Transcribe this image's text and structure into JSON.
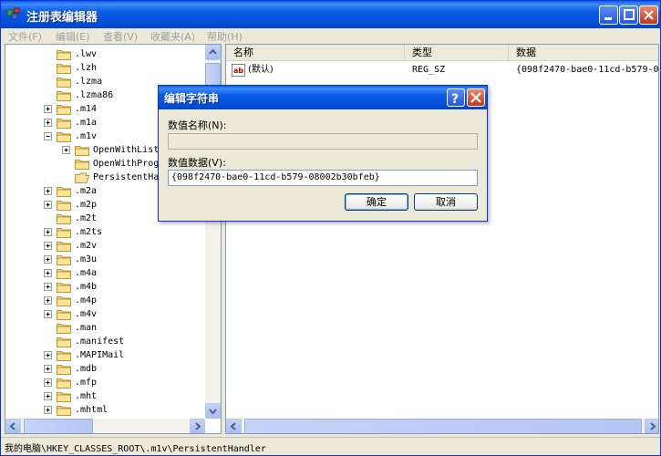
{
  "window": {
    "title": "注册表编辑器"
  },
  "menu": [
    "文件(F)",
    "编辑(E)",
    "查看(V)",
    "收藏夹(A)",
    "帮助(H)"
  ],
  "tree": {
    "rows": [
      {
        "label": ".lwv",
        "expander": false,
        "indent": 0
      },
      {
        "label": ".lzh",
        "expander": false,
        "indent": 0
      },
      {
        "label": ".lzma",
        "expander": false,
        "indent": 0
      },
      {
        "label": ".lzma86",
        "expander": false,
        "indent": 0
      },
      {
        "label": ".m14",
        "expander": true,
        "indent": 0
      },
      {
        "label": ".m1a",
        "expander": true,
        "indent": 0
      },
      {
        "label": ".m1v",
        "expander": "open",
        "indent": 0
      },
      {
        "label": "OpenWithList",
        "expander": true,
        "indent": 1
      },
      {
        "label": "OpenWithProgI",
        "expander": false,
        "indent": 1
      },
      {
        "label": "PersistentHan",
        "expander": false,
        "indent": 1,
        "open": true
      },
      {
        "label": ".m2a",
        "expander": true,
        "indent": 0
      },
      {
        "label": ".m2p",
        "expander": true,
        "indent": 0
      },
      {
        "label": ".m2t",
        "expander": false,
        "indent": 0
      },
      {
        "label": ".m2ts",
        "expander": true,
        "indent": 0
      },
      {
        "label": ".m2v",
        "expander": true,
        "indent": 0
      },
      {
        "label": ".m3u",
        "expander": true,
        "indent": 0
      },
      {
        "label": ".m4a",
        "expander": true,
        "indent": 0
      },
      {
        "label": ".m4b",
        "expander": true,
        "indent": 0
      },
      {
        "label": ".m4p",
        "expander": true,
        "indent": 0
      },
      {
        "label": ".m4v",
        "expander": true,
        "indent": 0
      },
      {
        "label": ".man",
        "expander": false,
        "indent": 0
      },
      {
        "label": ".manifest",
        "expander": false,
        "indent": 0
      },
      {
        "label": ".MAPIMail",
        "expander": true,
        "indent": 0
      },
      {
        "label": ".mdb",
        "expander": true,
        "indent": 0
      },
      {
        "label": ".mfp",
        "expander": true,
        "indent": 0
      },
      {
        "label": ".mht",
        "expander": true,
        "indent": 0
      },
      {
        "label": ".mhtml",
        "expander": true,
        "indent": 0
      }
    ]
  },
  "list": {
    "columns": [
      "名称",
      "类型",
      "数据"
    ],
    "rows": [
      {
        "icon": "ab",
        "name": "(默认)",
        "type": "REG_SZ",
        "data": "{098f2470-bae0-11cd-b579-08002b30bfeb}"
      }
    ]
  },
  "dialog": {
    "title": "编辑字符串",
    "name_label": "数值名称(N):",
    "name_value": "",
    "data_label": "数值数据(V):",
    "data_value": "{098f2470-bae0-11cd-b579-08002b30bfeb}",
    "ok": "确定",
    "cancel": "取消"
  },
  "status": {
    "path": "我的电脑\\HKEY_CLASSES_ROOT\\.m1v\\PersistentHandler"
  }
}
